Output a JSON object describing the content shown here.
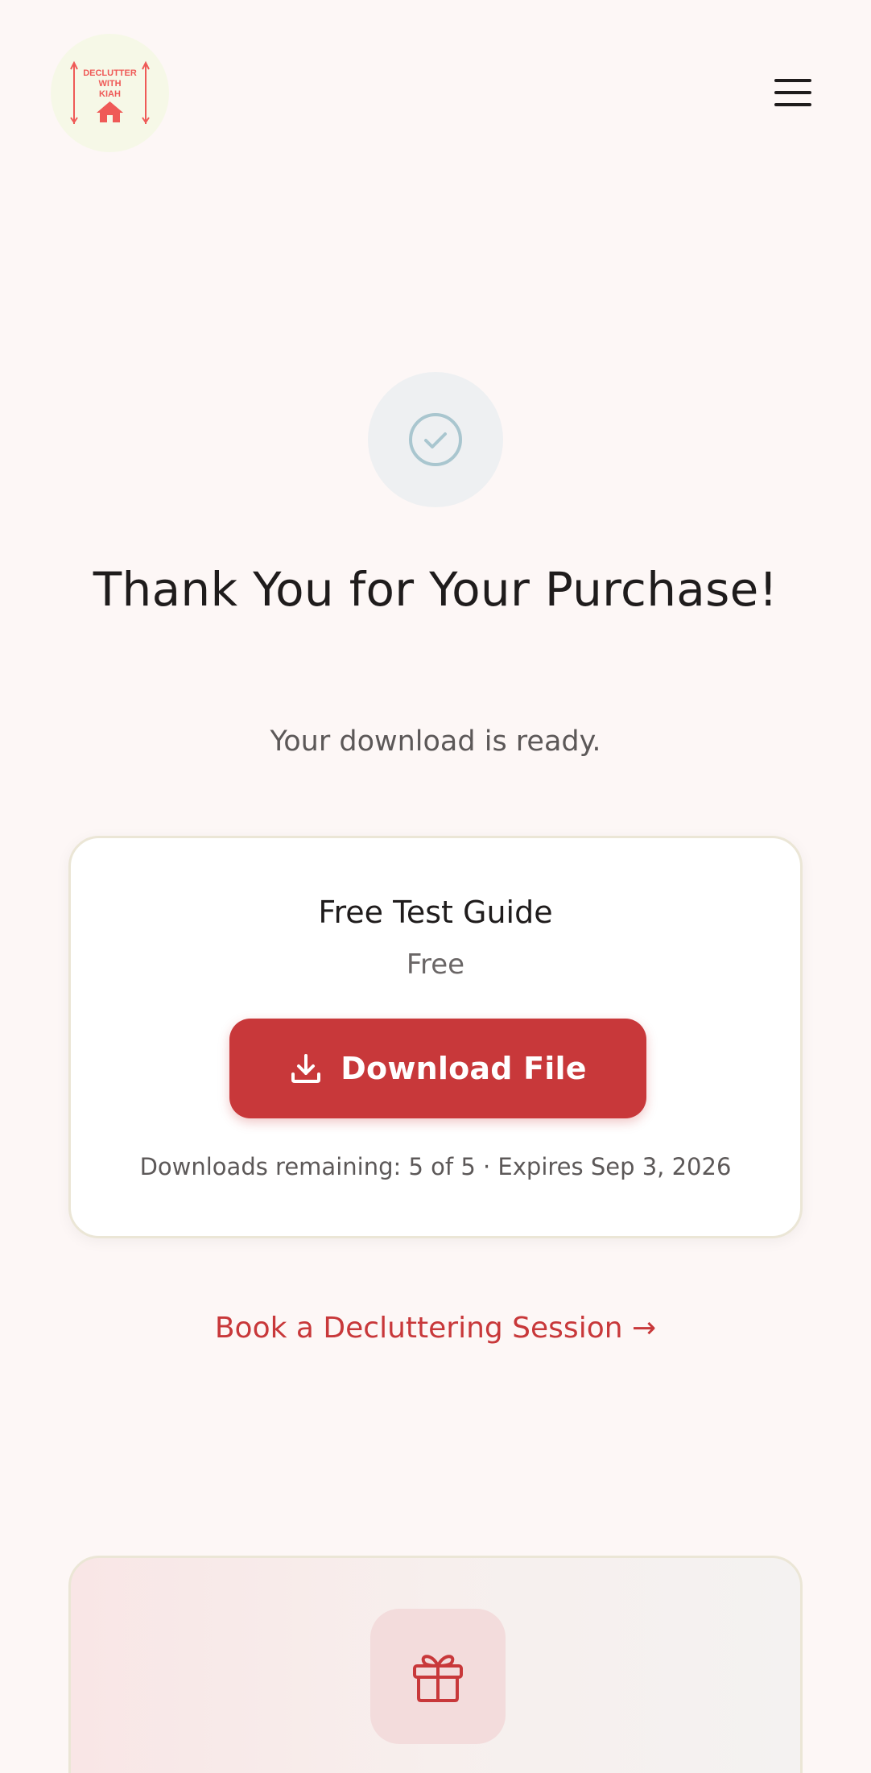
{
  "header": {
    "logo_text": [
      "DECLUTTER",
      "WITH",
      "KIAH"
    ],
    "logo_icon": "house-icon",
    "menu_icon": "hamburger-menu-icon"
  },
  "confirmation": {
    "status_icon": "check-circle-icon",
    "title": "Thank You for Your Purchase!",
    "subtitle": "Your download is ready."
  },
  "product": {
    "name": "Free Test Guide",
    "price": "Free",
    "download_icon": "download-icon",
    "download_label": "Download File",
    "meta": "Downloads remaining: 5 of 5 · Expires Sep 3, 2026"
  },
  "links": {
    "book_session": "Book a Decluttering Session →"
  },
  "promo": {
    "icon": "gift-icon"
  },
  "colors": {
    "accent": "#c8383a",
    "background": "#fdf7f6",
    "logo_bg": "#f6f8e7",
    "logo_ink": "#ef5a57",
    "check_stroke": "#a9c6cf"
  }
}
